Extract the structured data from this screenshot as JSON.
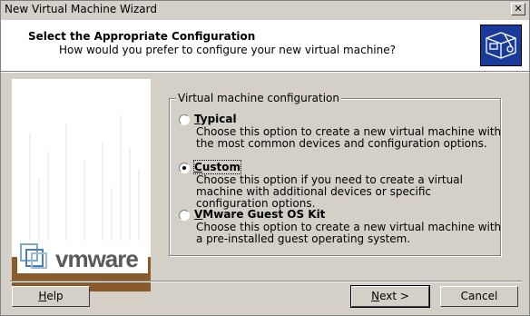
{
  "window": {
    "title": "New Virtual Machine Wizard",
    "close_glyph": "✕"
  },
  "header": {
    "title": "Select the Appropriate Configuration",
    "subtitle": "How would you prefer to configure your new virtual machine?",
    "icon": "vm-wizard-icon"
  },
  "sidebar": {
    "logo_text": "vmware",
    "logo_icon": "vmware-logo-icon"
  },
  "config": {
    "group_label": "Virtual machine configuration",
    "options": [
      {
        "label": "Typical",
        "selected": false,
        "description": "Choose this option to create a new virtual machine with the most common devices and configuration options."
      },
      {
        "label": "Custom",
        "selected": true,
        "description": "Choose this option if you need to create a virtual machine with additional devices or specific configuration options."
      },
      {
        "label": "VMware Guest OS Kit",
        "selected": false,
        "description": "Choose this option to create a new virtual machine with a pre-installed guest operating system."
      }
    ]
  },
  "buttons": {
    "help": "Help",
    "next": "Next >",
    "cancel": "Cancel"
  },
  "colors": {
    "dialog_bg": "#d4d0c8",
    "header_bg": "#ffffff",
    "brand_bar": "#8b5a2b",
    "icon_bg": "#1a3a9a"
  }
}
